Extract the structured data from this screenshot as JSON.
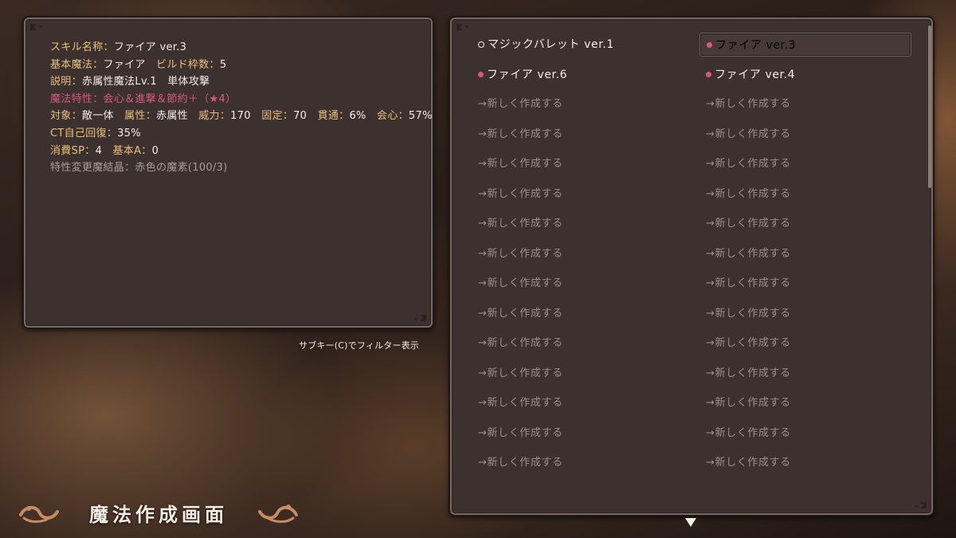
{
  "info": {
    "lines": [
      {
        "key": "スキル名称：",
        "value": "ファイア ver.3",
        "style": "normal"
      },
      {
        "key": "基本魔法：",
        "value": "ファイア",
        "key2": "ビルド枠数：",
        "value2": "5",
        "style": "normal"
      },
      {
        "key": "説明：",
        "value": "赤属性魔法Lv.1　単体攻撃",
        "style": "normal"
      },
      {
        "key": "魔法特性：",
        "value": "会心＆進撃＆節約＋（★4）",
        "style": "pink"
      },
      {
        "key": "対象：",
        "value": "敵一体",
        "key2": "属性：",
        "value2": "赤属性",
        "key3": "威力：",
        "value3": "170",
        "key4": "固定：",
        "value4": "70",
        "key5": "貫通：",
        "value5": "6%",
        "key6": "会心：",
        "value6": "57%",
        "style": "normal"
      },
      {
        "key": "CT自己回復：",
        "value": "35%",
        "style": "normal"
      },
      {
        "key": "消費SP：",
        "value": "4",
        "key2": "基本A：",
        "value2": "0",
        "style": "normal"
      },
      {
        "key": "特性変更魔結晶：",
        "value": "赤色の魔素(100/3)",
        "style": "gray"
      }
    ]
  },
  "hint": "サブキー(C)でフィルター表示",
  "list": {
    "slots": [
      {
        "label": "マジックバレット ver.1",
        "marker": "ring",
        "state": "filled"
      },
      {
        "label": "ファイア ver.3",
        "marker": "pink",
        "state": "selected"
      },
      {
        "label": "ファイア ver.6",
        "marker": "pink",
        "state": "filled"
      },
      {
        "label": "ファイア ver.4",
        "marker": "pink",
        "state": "filled"
      },
      {
        "label": "→新しく作成する",
        "marker": "none",
        "state": "empty"
      },
      {
        "label": "→新しく作成する",
        "marker": "none",
        "state": "empty"
      },
      {
        "label": "→新しく作成する",
        "marker": "none",
        "state": "empty"
      },
      {
        "label": "→新しく作成する",
        "marker": "none",
        "state": "empty"
      },
      {
        "label": "→新しく作成する",
        "marker": "none",
        "state": "empty"
      },
      {
        "label": "→新しく作成する",
        "marker": "none",
        "state": "empty"
      },
      {
        "label": "→新しく作成する",
        "marker": "none",
        "state": "empty"
      },
      {
        "label": "→新しく作成する",
        "marker": "none",
        "state": "empty"
      },
      {
        "label": "→新しく作成する",
        "marker": "none",
        "state": "empty"
      },
      {
        "label": "→新しく作成する",
        "marker": "none",
        "state": "empty"
      },
      {
        "label": "→新しく作成する",
        "marker": "none",
        "state": "empty"
      },
      {
        "label": "→新しく作成する",
        "marker": "none",
        "state": "empty"
      },
      {
        "label": "→新しく作成する",
        "marker": "none",
        "state": "empty"
      },
      {
        "label": "→新しく作成する",
        "marker": "none",
        "state": "empty"
      },
      {
        "label": "→新しく作成する",
        "marker": "none",
        "state": "empty"
      },
      {
        "label": "→新しく作成する",
        "marker": "none",
        "state": "empty"
      },
      {
        "label": "→新しく作成する",
        "marker": "none",
        "state": "empty"
      },
      {
        "label": "→新しく作成する",
        "marker": "none",
        "state": "empty"
      },
      {
        "label": "→新しく作成する",
        "marker": "none",
        "state": "empty"
      },
      {
        "label": "→新しく作成する",
        "marker": "none",
        "state": "empty"
      },
      {
        "label": "→新しく作成する",
        "marker": "none",
        "state": "empty"
      },
      {
        "label": "→新しく作成する",
        "marker": "none",
        "state": "empty"
      },
      {
        "label": "→新しく作成する",
        "marker": "none",
        "state": "empty"
      },
      {
        "label": "→新しく作成する",
        "marker": "none",
        "state": "empty"
      },
      {
        "label": "→新しく作成する",
        "marker": "none",
        "state": "empty"
      },
      {
        "label": "→新しく作成する",
        "marker": "none",
        "state": "empty"
      }
    ]
  },
  "screen_title": "魔法作成画面",
  "colors": {
    "panel": "#3d3130",
    "key": "#e8c07a",
    "value": "#f2ece6",
    "accent_pink": "#d9577c",
    "muted": "#9c908a"
  },
  "icons": {
    "scroll_down": "triangle-down-icon",
    "left_ornament": "swirl-ornament-icon",
    "right_ornament": "swirl-ornament-icon"
  }
}
